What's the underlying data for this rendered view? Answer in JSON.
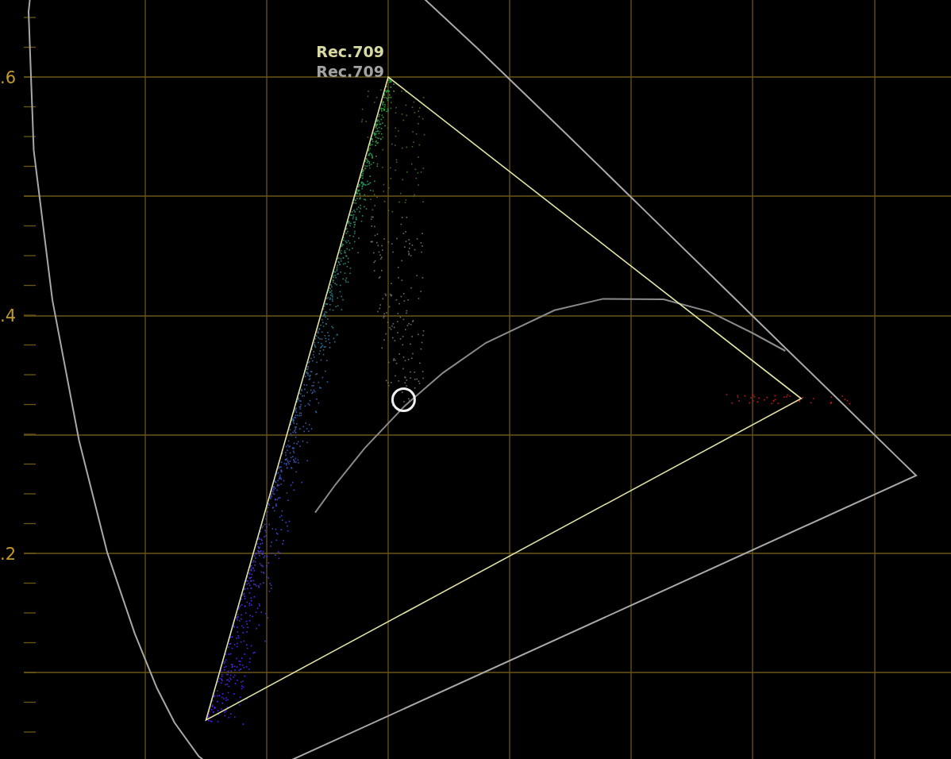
{
  "scope": {
    "y_axis_labels": [
      ".6",
      ".4",
      ".2"
    ],
    "gamut_labels": [
      {
        "kind": "target",
        "text": "Rec.709"
      },
      {
        "kind": "source",
        "text": "Rec.709"
      }
    ]
  }
}
